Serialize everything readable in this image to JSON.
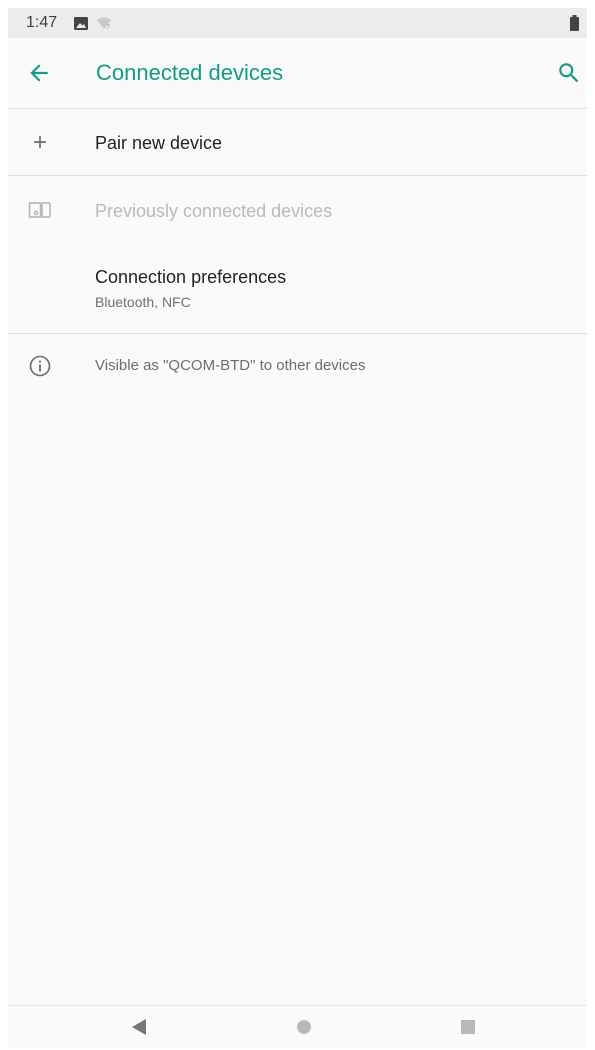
{
  "status_bar": {
    "time": "1:47",
    "icons": [
      "image-icon",
      "wifi-icon",
      "battery-icon"
    ]
  },
  "app_bar": {
    "title": "Connected devices",
    "back_icon": "arrow-back-icon",
    "search_icon": "search-icon",
    "accent_color": "#109d84"
  },
  "list": {
    "pair_new": {
      "icon": "plus-icon",
      "title": "Pair new device"
    },
    "previously_connected": {
      "icon": "devices-icon",
      "title": "Previously connected devices"
    },
    "connection_preferences": {
      "title": "Connection preferences",
      "summary": "Bluetooth, NFC"
    }
  },
  "footer": {
    "icon": "info-icon",
    "text": "Visible as \"QCOM-BTD\" to other devices"
  },
  "nav_bar": {
    "back_icon": "nav-back-triangle-icon",
    "home_icon": "nav-home-circle-icon",
    "recents_icon": "nav-recents-square-icon"
  }
}
